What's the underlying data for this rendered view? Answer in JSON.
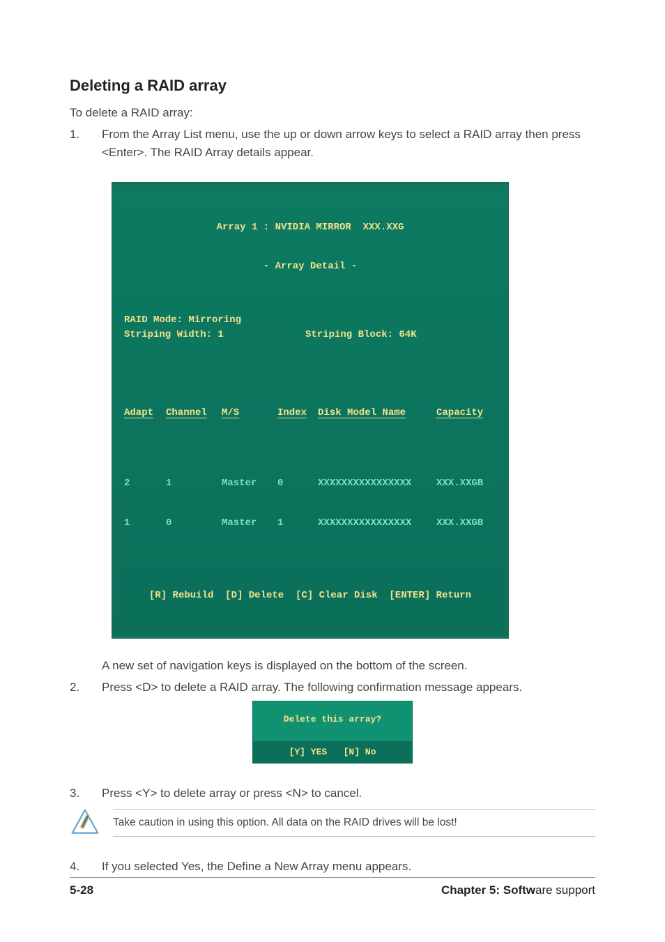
{
  "heading": "Deleting a RAID array",
  "intro": "To delete a RAID array:",
  "steps": {
    "s1": {
      "num": "1.",
      "text": "From the Array List menu, use the up or down arrow keys to select a RAID array then press <Enter>. The RAID Array details appear."
    },
    "s1b": {
      "text": "A new set of  navigation keys is displayed on the bottom of the screen."
    },
    "s2": {
      "num": "2.",
      "text": "Press <D> to delete a RAID array. The following confirmation message appears."
    },
    "s3": {
      "num": "3.",
      "text": "Press <Y> to delete array or press <N> to cancel."
    },
    "s4": {
      "num": "4.",
      "text": "If you selected Yes, the Define a New Array menu appears."
    }
  },
  "bios": {
    "title": "Array 1 : NVIDIA MIRROR  XXX.XXG",
    "subtitle": "- Array Detail -",
    "raid_mode_label": "RAID Mode: Mirroring",
    "striping_width_label": "Striping Width: 1",
    "striping_block_label": "Striping Block: 64K",
    "headers": {
      "adapt": "Adapt",
      "channel": "Channel",
      "ms": "M/S",
      "index": "Index",
      "model": "Disk Model Name",
      "capacity": "Capacity"
    },
    "rows": [
      {
        "adapt": "2",
        "channel": "1",
        "ms": "Master",
        "index": "0",
        "model": "XXXXXXXXXXXXXXXX",
        "capacity": "XXX.XXGB"
      },
      {
        "adapt": "1",
        "channel": "0",
        "ms": "Master",
        "index": "1",
        "model": "XXXXXXXXXXXXXXXX",
        "capacity": "XXX.XXGB"
      }
    ],
    "footer": "[R] Rebuild  [D] Delete  [C] Clear Disk  [ENTER] Return"
  },
  "dialog": {
    "question": "Delete this array?",
    "options": "[Y] YES   [N] No"
  },
  "caution": {
    "icon_name": "caution-icon",
    "text": "Take caution in using this option. All data on the RAID drives will be lost!"
  },
  "footer": {
    "page": "5-28",
    "chapter_bold": "Chapter 5: Softw",
    "chapter_rest": "are support"
  }
}
